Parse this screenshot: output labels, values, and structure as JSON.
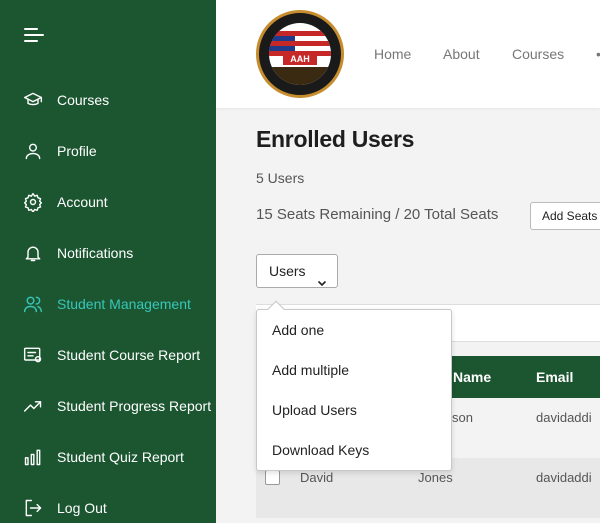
{
  "sidebar": {
    "items": [
      {
        "label": "Courses",
        "icon": "graduation-cap-icon"
      },
      {
        "label": "Profile",
        "icon": "user-icon"
      },
      {
        "label": "Account",
        "icon": "gear-icon"
      },
      {
        "label": "Notifications",
        "icon": "bell-icon"
      },
      {
        "label": "Student Management",
        "icon": "users-icon",
        "active": true
      },
      {
        "label": "Student Course Report",
        "icon": "report-icon"
      },
      {
        "label": "Student Progress Report",
        "icon": "trending-up-icon"
      },
      {
        "label": "Student Quiz Report",
        "icon": "bar-chart-icon"
      },
      {
        "label": "Log Out",
        "icon": "logout-icon"
      }
    ],
    "active_color": "#38c6b8",
    "background": "#1b5631"
  },
  "header": {
    "logo_mark": "AAH",
    "nav": {
      "home": "Home",
      "about": "About",
      "courses": "Courses",
      "more": "•"
    }
  },
  "main": {
    "title": "Enrolled Users",
    "user_count": "5 Users",
    "seats": "15 Seats Remaining / 20 Total Seats",
    "add_seats_label": "Add Seats",
    "users_dropdown_label": "Users",
    "table": {
      "headers": {
        "last_name": "Name",
        "email": "Email"
      },
      "rows": [
        {
          "first": "",
          "last": "son",
          "email": "davidaddi"
        },
        {
          "first": "David",
          "last": "Jones",
          "email": "davidaddi"
        }
      ]
    },
    "menu": {
      "items": [
        "Add one",
        "Add multiple",
        "Upload Users",
        "Download Keys"
      ]
    }
  }
}
